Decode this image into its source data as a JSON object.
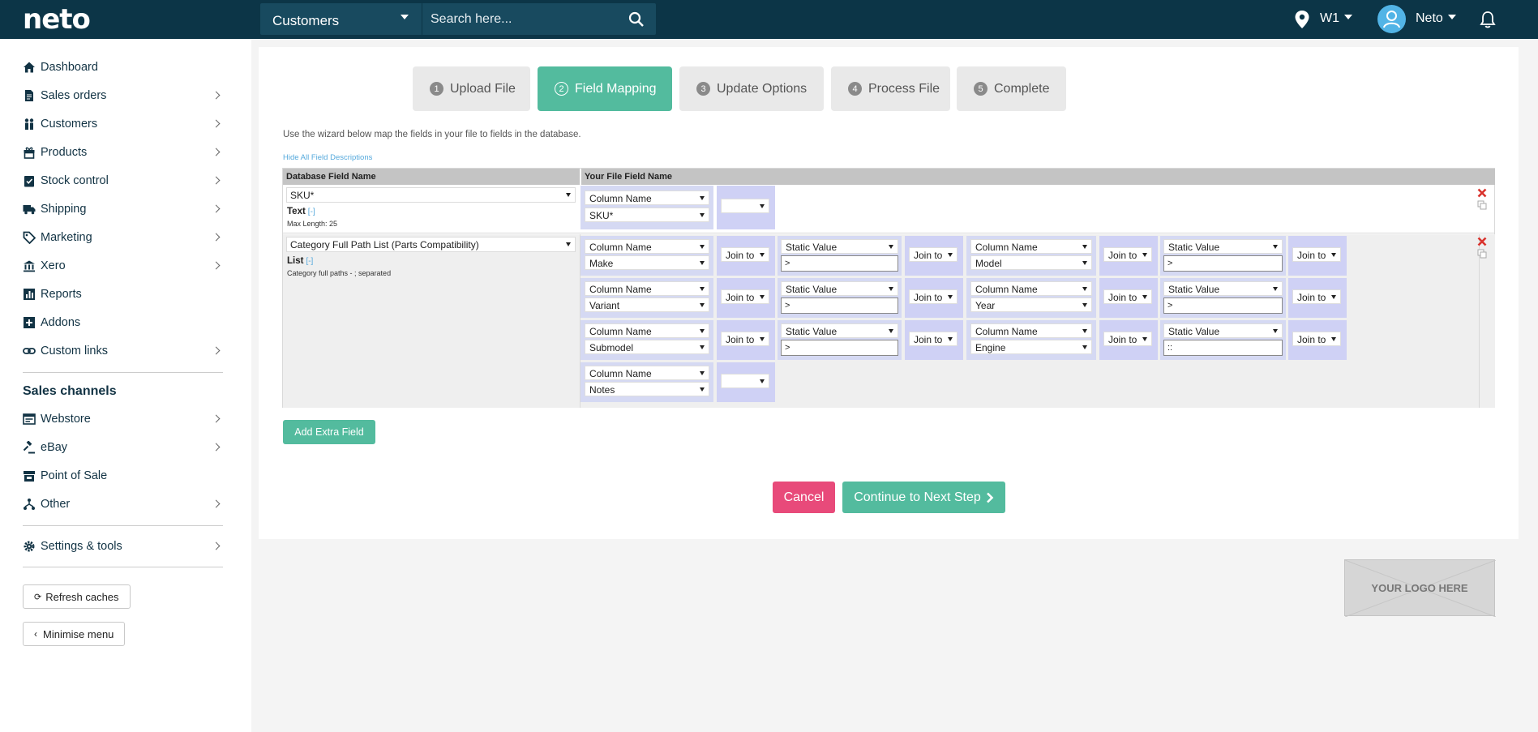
{
  "app": {
    "logo": "neto"
  },
  "header": {
    "search_scope": "Customers",
    "search_placeholder": "Search here...",
    "location": "W1",
    "user": "Neto"
  },
  "sidebar": {
    "items": [
      {
        "label": "Dashboard",
        "icon": "home-icon"
      },
      {
        "label": "Sales orders",
        "icon": "document-icon"
      },
      {
        "label": "Customers",
        "icon": "users-icon"
      },
      {
        "label": "Products",
        "icon": "gift-icon"
      },
      {
        "label": "Stock control",
        "icon": "clipboard-check-icon"
      },
      {
        "label": "Shipping",
        "icon": "truck-icon"
      },
      {
        "label": "Marketing",
        "icon": "tag-icon"
      },
      {
        "label": "Xero",
        "icon": "bank-icon"
      },
      {
        "label": "Reports",
        "icon": "chart-icon"
      },
      {
        "label": "Addons",
        "icon": "plus-square-icon"
      },
      {
        "label": "Custom links",
        "icon": "link-icon"
      }
    ],
    "sales_channels_heading": "Sales channels",
    "channels": [
      {
        "label": "Webstore",
        "icon": "browser-icon"
      },
      {
        "label": "eBay",
        "icon": "gavel-icon"
      },
      {
        "label": "Point of Sale",
        "icon": "store-icon"
      },
      {
        "label": "Other",
        "icon": "network-icon"
      }
    ],
    "settings": "Settings & tools",
    "refresh_caches": "Refresh caches",
    "minimise_menu": "Minimise menu"
  },
  "wizard": {
    "steps": [
      {
        "num": "1",
        "label": "Upload File"
      },
      {
        "num": "2",
        "label": "Field Mapping"
      },
      {
        "num": "3",
        "label": "Update Options"
      },
      {
        "num": "4",
        "label": "Process File"
      },
      {
        "num": "5",
        "label": "Complete"
      }
    ],
    "active_step": 2,
    "intro": "Use the wizard below map the fields in your file to fields in the database.",
    "hide_descriptions": "Hide All Field Descriptions"
  },
  "mapping": {
    "col_db": "Database Field Name",
    "col_file": "Your File Field Name",
    "row1": {
      "db_field": "SKU*",
      "type": "Text",
      "toggle": "[-]",
      "desc": "Max Length: 25",
      "source_type": "Column Name",
      "source_value": "SKU*"
    },
    "row2": {
      "db_field": "Category Full Path List (Parts Compatibility)",
      "type": "List",
      "toggle": "[-]",
      "desc": "Category full paths - ; separated",
      "column_name": "Column Name",
      "static_value": "Static Value",
      "join_to": "Join to",
      "values": {
        "make": "Make",
        "model": "Model",
        "variant": "Variant",
        "year": "Year",
        "submodel": "Submodel",
        "engine": "Engine",
        "notes": "Notes",
        "sep_gt": ">",
        "sep_colons": "::"
      }
    }
  },
  "buttons": {
    "add_extra_field": "Add Extra Field",
    "cancel": "Cancel",
    "continue": "Continue to Next Step"
  },
  "logo_placeholder": "YOUR LOGO HERE",
  "colors": {
    "header_bg": "#0c3547",
    "accent_green": "#53bb9e",
    "cancel_pink": "#e84a7a",
    "link_blue": "#55a9dc"
  }
}
